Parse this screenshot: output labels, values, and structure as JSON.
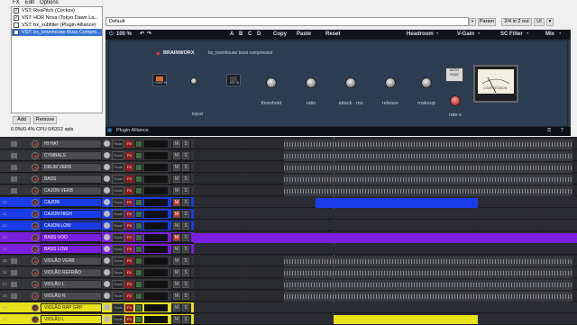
{
  "fx_window": {
    "menu": [
      "FX",
      "Edit",
      "Options"
    ],
    "chain": [
      {
        "label": "VST: ReaPitch (Cockos)",
        "checked": true,
        "selected": false
      },
      {
        "label": "VST: HDR Nova (Tokyo Dawn La...",
        "checked": true,
        "selected": false
      },
      {
        "label": "VST: bx_subfilter (Plugin Alliance)",
        "checked": false,
        "selected": false
      },
      {
        "label": "VST: bx_townhouse Buss Compre...",
        "checked": false,
        "selected": true
      }
    ],
    "add_label": "Add",
    "remove_label": "Remove",
    "status": "0.0%/0.4% CPU 0/6312 spls",
    "preset": "Default",
    "toolbar": {
      "plus": "+",
      "param": "Param",
      "io": "2/4 in 2 out",
      "ui": "UI"
    }
  },
  "plugin": {
    "zoom": "100 %",
    "slots": [
      "A",
      "B",
      "C",
      "D"
    ],
    "actions": [
      "Copy",
      "Paste",
      "Reset"
    ],
    "headroom": "Headroom",
    "vgain": "V-Gain",
    "scfilter": "SC Filter",
    "mix": "Mix",
    "brand": "BRAINWORX",
    "model": "bx_townhouse buss compressor",
    "comp_in": "COMP IN",
    "key_in": "KEY IN",
    "input": "input",
    "threshold": "threshold",
    "ratio": "ratio",
    "attack": "attack · ms",
    "release": "release",
    "makeup": "makeup",
    "rate_s": "rate-s",
    "auto_fade": "AUTO FADE",
    "compression": "COMPRESSION",
    "footer": "Plugin Alliance"
  },
  "tracks": [
    {
      "num": "",
      "name": "HI HAT",
      "color": "#3a3b3f",
      "clip_color": "#3a3b3f",
      "mute": false
    },
    {
      "num": "",
      "name": "CYMBALS",
      "color": "#3a3b3f",
      "clip_color": "#3a3b3f",
      "mute": false
    },
    {
      "num": "",
      "name": "DRUM VERB",
      "color": "#3a3b3f",
      "clip_color": "#3a3b3f",
      "mute": false
    },
    {
      "num": "",
      "name": "BASS",
      "color": "#3a3b3f",
      "clip_color": "#3a3b3f",
      "mute": false
    },
    {
      "num": "",
      "name": "CAJON VERB",
      "color": "#3a3b3f",
      "clip_color": "#3a3b3f",
      "mute": false
    },
    {
      "num": "10",
      "name": "CAJON",
      "color": "#1a3be8",
      "clip_color": "#1a3be8",
      "mute": true
    },
    {
      "num": "11",
      "name": "CAJON HIGH",
      "color": "#1a3be8",
      "clip_color": "#1a3be8",
      "mute": true
    },
    {
      "num": "12",
      "name": "CAJON LOW",
      "color": "#1a3be8",
      "clip_color": "#1a3be8",
      "mute": false
    },
    {
      "num": "13",
      "name": "BASS VOO",
      "color": "#7a1ee0",
      "clip_color": "#7a1ee0",
      "mute": true
    },
    {
      "num": "14",
      "name": "BASS LOW",
      "color": "#7a1ee0",
      "clip_color": "#7a1ee0",
      "mute": false
    },
    {
      "num": "15",
      "name": "VIOLÃO VERB",
      "color": "#3a3b3f",
      "clip_color": "#3a3b3f",
      "mute": false
    },
    {
      "num": "16",
      "name": "VIOLÃO REFRÃO",
      "color": "#3a3b3f",
      "clip_color": "#3a3b3f",
      "mute": false
    },
    {
      "num": "17",
      "name": "VIOLÃO L",
      "color": "#3a3b3f",
      "clip_color": "#3a3b3f",
      "mute": false
    },
    {
      "num": "18",
      "name": "VIOLÃO R",
      "color": "#3a3b3f",
      "clip_color": "#3a3b3f",
      "mute": false
    },
    {
      "num": "19",
      "name": "VIOLÃO RAP GRP",
      "color": "#e8e21a",
      "clip_color": "#e8e21a",
      "mute": false
    },
    {
      "num": "20",
      "name": "VIOLÃO L",
      "color": "#e8e21a",
      "clip_color": "#e8e21a",
      "mute": false
    }
  ],
  "track_ui": {
    "route": "Route",
    "fx": "FX",
    "mute": "M",
    "solo": "S"
  }
}
